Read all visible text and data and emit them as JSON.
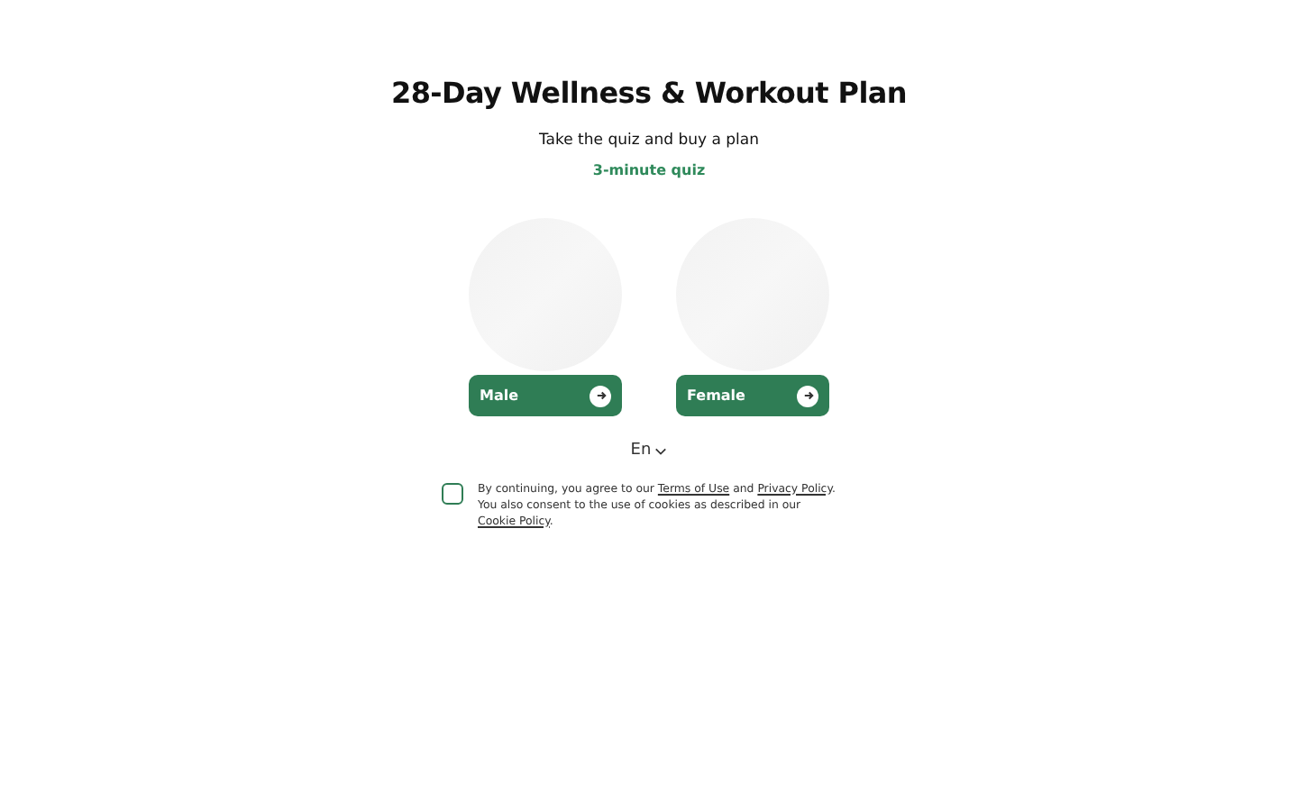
{
  "title": "28-Day Wellness & Workout Plan",
  "subtitle": "Take the quiz and buy a plan",
  "quiz_length": "3-minute quiz",
  "options": [
    {
      "label": "Male"
    },
    {
      "label": "Female"
    }
  ],
  "language": "En",
  "consent": {
    "checked": false,
    "segments": [
      {
        "kind": "text",
        "text": "By continuing, you agree to our "
      },
      {
        "kind": "link",
        "text": "Terms of Use"
      },
      {
        "kind": "text",
        "text": " and "
      },
      {
        "kind": "link",
        "text": "Privacy Policy"
      },
      {
        "kind": "text",
        "text": ". You also consent to the use of cookies as described in our "
      },
      {
        "kind": "link",
        "text": "Cookie Policy"
      },
      {
        "kind": "text",
        "text": "."
      }
    ]
  }
}
